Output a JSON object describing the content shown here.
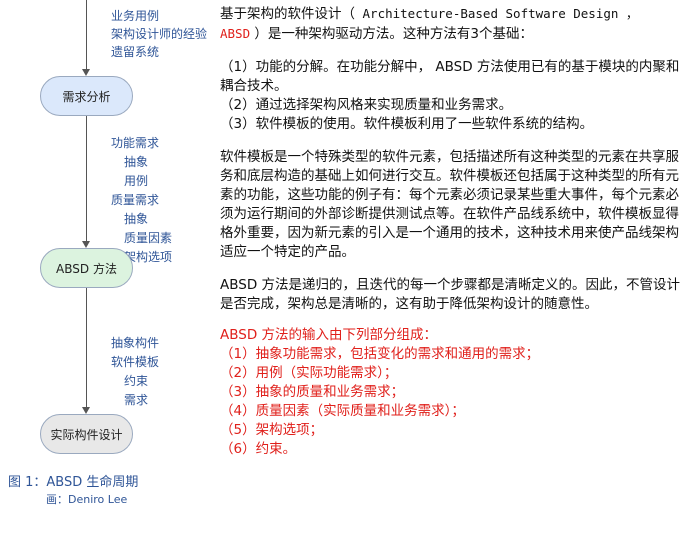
{
  "diagram": {
    "inputs_top": [
      "业务用例",
      "架构设计师的经验",
      "遗留系统"
    ],
    "node_requirements": "需求分析",
    "mid_outputs": {
      "functional": "功能需求",
      "functional_items": [
        "抽象",
        "用例"
      ],
      "quality": "质量需求",
      "quality_items": [
        "抽象",
        "质量因素",
        "架构选项"
      ]
    },
    "node_absd": "ABSD 方法",
    "bottom_outputs": {
      "items": [
        "抽象构件",
        "软件模板"
      ],
      "sub_items": [
        "约束",
        "需求"
      ]
    },
    "node_impl": "实际构件设计",
    "caption": "图 1：ABSD 生命周期",
    "credit": "画：Deniro Lee"
  },
  "text": {
    "intro_a": "基于架构的软件设计（",
    "intro_en": " Architecture-Based Software Design ，",
    "intro_abbr": "ABSD",
    "intro_b": " ）是一种架构驱动方法。这种方法有3个基础：",
    "basis": [
      "（1）功能的分解。在功能分解中， ABSD 方法使用已有的基于模块的内聚和耦合技术。",
      "（2）通过选择架构风格来实现质量和业务需求。",
      "（3）软件模板的使用。软件模板利用了一些软件系统的结构。"
    ],
    "para_template": "软件模板是一个特殊类型的软件元素，包括描述所有这种类型的元素在共享服务和底层构造的基础上如何进行交互。软件模板还包括属于这种类型的所有元素的功能，这些功能的例子有：每个元素必须记录某些重大事件，每个元素必须为运行期间的外部诊断提供测试点等。在软件产品线系统中，软件模板显得格外重要，因为新元素的引入是一个通用的技术，这种技术用来使产品线架构适应一个特定的产品。",
    "para_recursive": "ABSD 方法是递归的，且迭代的每一个步骤都是清晰定义的。因此，不管设计是否完成，架构总是清晰的，这有助于降低架构设计的随意性。",
    "inputs_heading": "ABSD 方法的输入由下列部分组成：",
    "inputs": [
      "（1）抽象功能需求，包括变化的需求和通用的需求；",
      "（2）用例（实际功能需求）；",
      "（3）抽象的质量和业务需求；",
      "（4）质量因素（实际质量和业务需求）；",
      "（5）架构选项；",
      "（6）约束。"
    ]
  },
  "colors": {
    "label_blue": "#2f5597",
    "node_req_fill": "#dbe8fb",
    "node_absd_fill": "#dcf3df",
    "node_impl_fill": "#e8e8e8",
    "highlight_red": "#e0201b"
  }
}
